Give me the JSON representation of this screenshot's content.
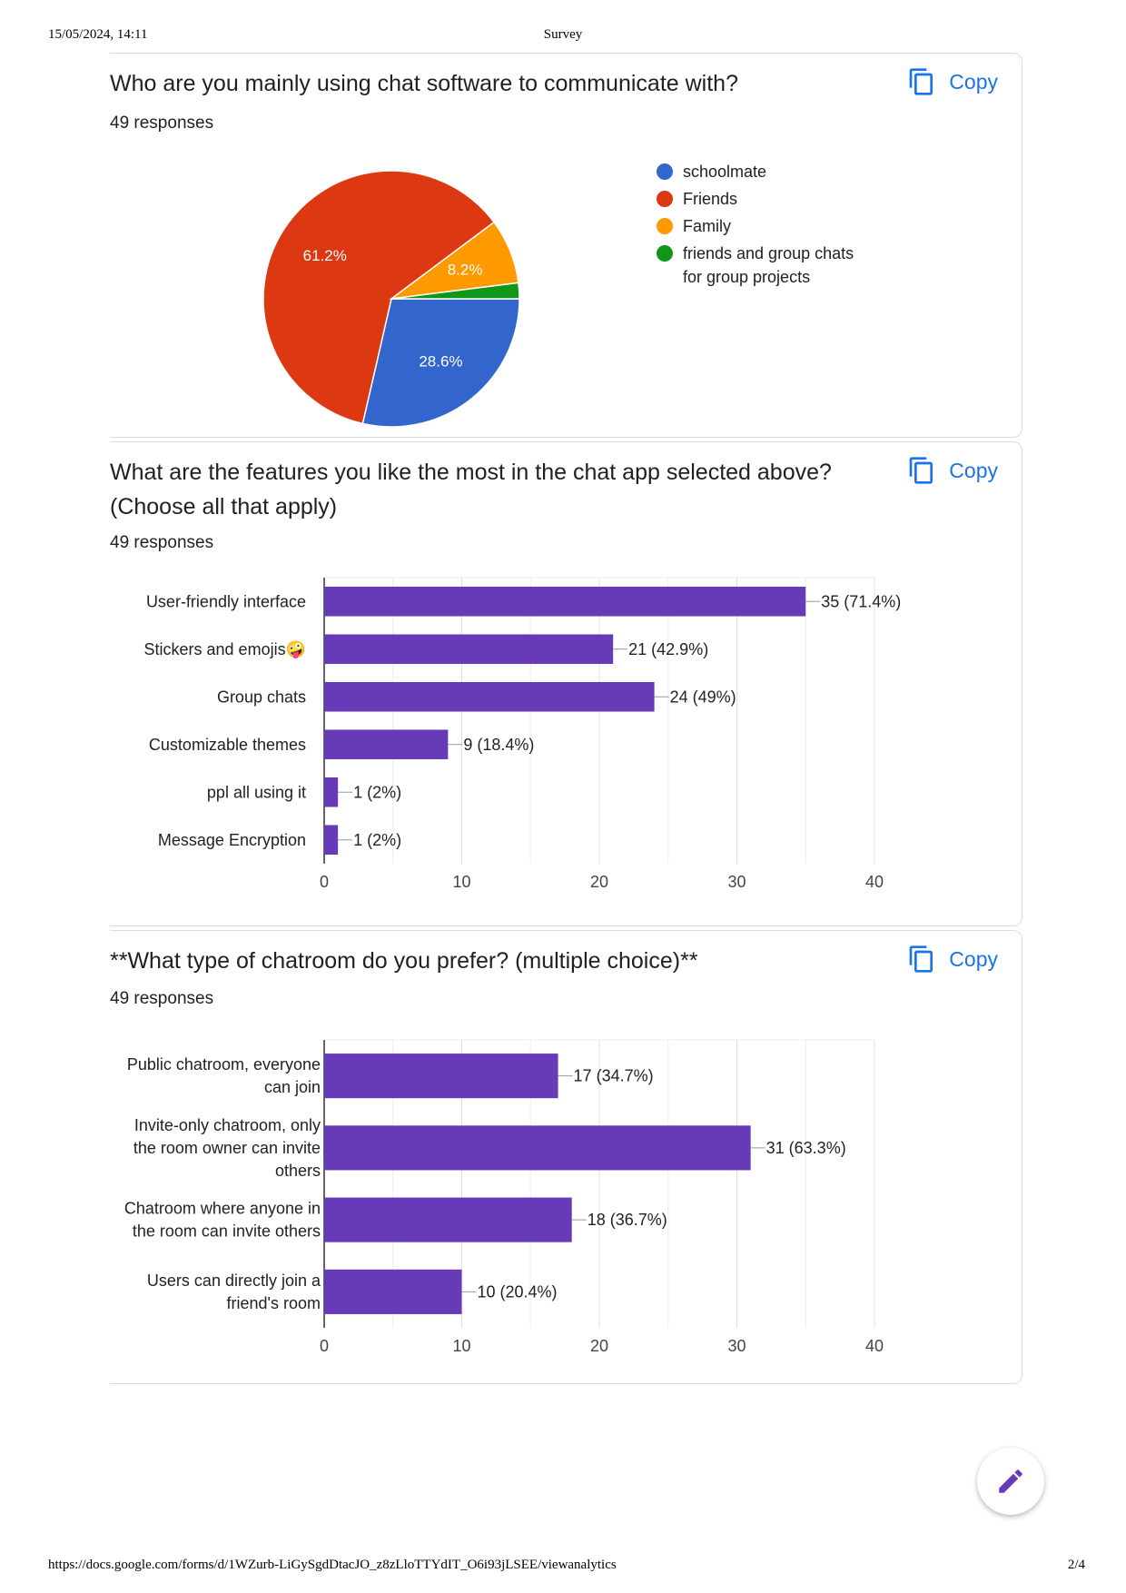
{
  "page": {
    "header_left": "15/05/2024, 14:11",
    "header_center": "Survey",
    "footer_left": "https://docs.google.com/forms/d/1WZurb-LiGySgdDtacJO_z8zLloTTYdIT_O6i93jLSEE/viewanalytics",
    "footer_right": "2/4"
  },
  "copy_label": "Copy",
  "icons": {
    "copy": "copy-icon",
    "edit": "pencil-edit-icon"
  },
  "colors": {
    "accent_blue": "#1a73e8",
    "bar_purple": "#673ab7"
  },
  "questions": [
    {
      "title": "Who are you mainly using chat software to communicate with?",
      "responses": "49 responses"
    },
    {
      "title": "What are the features you like the most in the chat app selected above? (Choose all that apply)",
      "responses": "49 responses"
    },
    {
      "title": "**What type of chatroom do you prefer? (multiple choice)**",
      "responses": "49 responses"
    }
  ],
  "chart_data": [
    {
      "type": "pie",
      "categories": [
        "schoolmate",
        "Friends",
        "Family",
        "friends and group chats for group projects"
      ],
      "values": [
        28.6,
        61.2,
        8.2,
        2.0
      ],
      "slice_labels": [
        "28.6%",
        "61.2%",
        "8.2%",
        ""
      ],
      "colors": [
        "#3366cc",
        "#dc3912",
        "#ff9900",
        "#109618"
      ],
      "legend": "right"
    },
    {
      "type": "bar",
      "orientation": "horizontal",
      "categories": [
        "User-friendly interface",
        "Stickers and emojis🤪",
        "Group chats",
        "Customizable themes",
        "ppl all using it",
        "Message Encryption"
      ],
      "values": [
        35,
        21,
        24,
        9,
        1,
        1
      ],
      "data_labels": [
        "35 (71.4%)",
        "21 (42.9%)",
        "24 (49%)",
        "9 (18.4%)",
        "1 (2%)",
        "1 (2%)"
      ],
      "xlim": [
        0,
        40
      ],
      "xticks": [
        "0",
        "10",
        "20",
        "30",
        "40"
      ],
      "grid": true
    },
    {
      "type": "bar",
      "orientation": "horizontal",
      "categories": [
        [
          "Public chatroom, everyone",
          "can join"
        ],
        [
          "Invite-only chatroom, only",
          "the room owner can invite",
          "others"
        ],
        [
          "Chatroom where anyone in",
          "the room can invite others"
        ],
        [
          "Users can directly join a",
          "friend's room"
        ]
      ],
      "values": [
        17,
        31,
        18,
        10
      ],
      "data_labels": [
        "17 (34.7%)",
        "31 (63.3%)",
        "18 (36.7%)",
        "10 (20.4%)"
      ],
      "xlim": [
        0,
        40
      ],
      "xticks": [
        "0",
        "10",
        "20",
        "30",
        "40"
      ],
      "grid": true
    }
  ]
}
